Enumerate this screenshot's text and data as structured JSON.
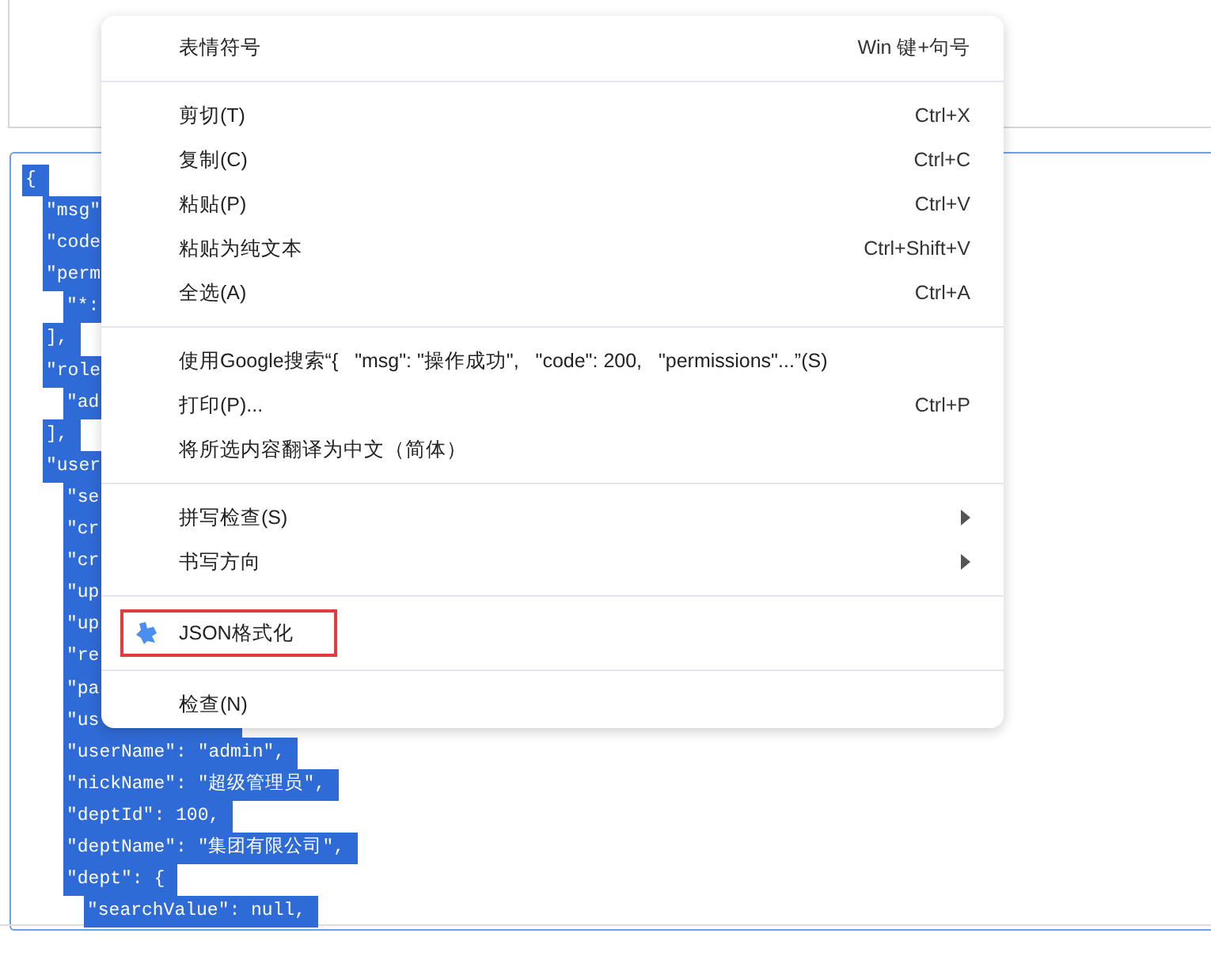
{
  "code_lines": [
    {
      "text": "{",
      "children": [
        {
          "text": "\"msg\"",
          "covered": true
        },
        {
          "text": "\"code",
          "covered": true
        },
        {
          "text": "\"perm",
          "covered": true,
          "children": [
            {
              "text": "\"*:",
              "covered": true
            }
          ]
        },
        {
          "text": "],",
          "covered": false
        },
        {
          "text": "\"role",
          "covered": true,
          "children": [
            {
              "text": "\"ad",
              "covered": true
            }
          ]
        },
        {
          "text": "],",
          "covered": false
        },
        {
          "text": "\"user",
          "covered": true,
          "children": [
            {
              "text": "\"se",
              "covered": true
            },
            {
              "text": "\"cr",
              "covered": true
            },
            {
              "text": "\"cr",
              "covered": true
            },
            {
              "text": "\"up",
              "covered": true
            },
            {
              "text": "\"up",
              "covered": true
            },
            {
              "text": "\"re",
              "covered": true
            },
            {
              "text": "\"pa",
              "covered": true
            },
            {
              "text": "\"us",
              "covered": true
            },
            {
              "text": "\"userName\": \"admin\",",
              "covered": false
            },
            {
              "text": "\"nickName\": \"超级管理员\",",
              "covered": false
            },
            {
              "text": "\"deptId\": 100,",
              "covered": false
            },
            {
              "text": "\"deptName\": \"集团有限公司\",",
              "covered": false
            },
            {
              "text": "\"dept\": {",
              "covered": false,
              "children": [
                {
                  "text": "\"searchValue\": null,",
                  "covered": false
                }
              ]
            }
          ]
        }
      ]
    }
  ],
  "context_menu": {
    "groups": [
      [
        {
          "label": "表情符号",
          "shortcut": "Win 键+句号",
          "submenu": false,
          "outlined": false
        }
      ],
      [
        {
          "label": "剪切(T)",
          "shortcut": "Ctrl+X",
          "submenu": false,
          "outlined": false
        },
        {
          "label": "复制(C)",
          "shortcut": "Ctrl+C",
          "submenu": false,
          "outlined": false
        },
        {
          "label": "粘贴(P)",
          "shortcut": "Ctrl+V",
          "submenu": false,
          "outlined": false
        },
        {
          "label": "粘贴为纯文本",
          "shortcut": "Ctrl+Shift+V",
          "submenu": false,
          "outlined": false
        },
        {
          "label": "全选(A)",
          "shortcut": "Ctrl+A",
          "submenu": false,
          "outlined": false
        }
      ],
      [
        {
          "label": "使用Google搜索“{   \"msg\": \"操作成功\",   \"code\": 200,   \"permissions\"...”(S)",
          "submenu": false,
          "outlined": false
        },
        {
          "label": "打印(P)...",
          "shortcut": "Ctrl+P",
          "submenu": false,
          "outlined": false
        },
        {
          "label": "将所选内容翻译为中文（简体）",
          "submenu": false,
          "outlined": false
        }
      ],
      [
        {
          "label": "拼写检查(S)",
          "submenu": true,
          "outlined": false
        },
        {
          "label": "书写方向",
          "submenu": true,
          "outlined": false
        }
      ],
      [
        {
          "label": "JSON格式化",
          "kind": "extension",
          "submenu": false,
          "outlined": true
        }
      ],
      [
        {
          "label": "检查(N)",
          "submenu": false,
          "outlined": false
        }
      ]
    ]
  }
}
